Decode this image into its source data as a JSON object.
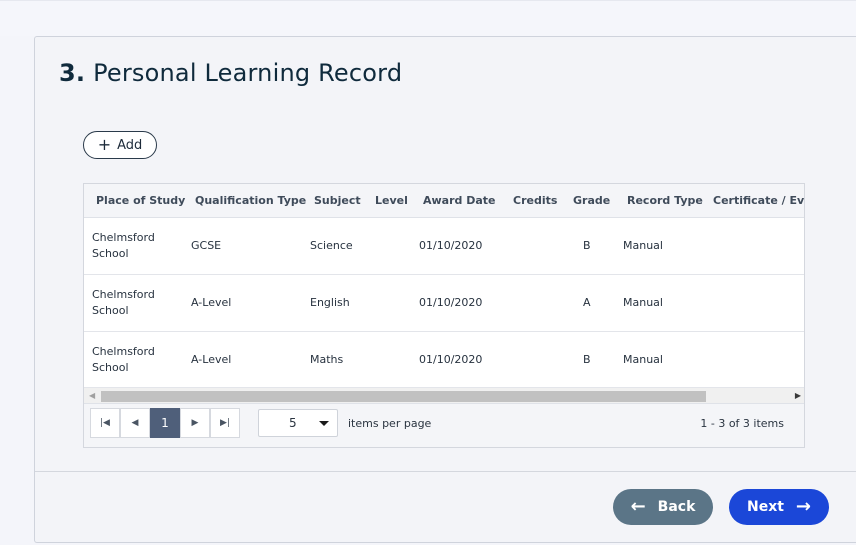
{
  "section": {
    "number": "3.",
    "title": "Personal Learning Record"
  },
  "add_button": {
    "icon": "plus-icon",
    "label": "Add"
  },
  "table": {
    "columns": [
      "Place of Study",
      "Qualification Type",
      "Subject",
      "Level",
      "Award Date",
      "Credits",
      "Grade",
      "Record Type",
      "Certificate / Evidence"
    ],
    "rows": [
      {
        "place_line1": "Chelmsford",
        "place_line2": "School",
        "qualification": "GCSE",
        "subject": "Science",
        "level": "",
        "award_date": "01/10/2020",
        "credits": "",
        "grade": "B",
        "record_type": "Manual"
      },
      {
        "place_line1": "Chelmsford",
        "place_line2": "School",
        "qualification": "A-Level",
        "subject": "English",
        "level": "",
        "award_date": "01/10/2020",
        "credits": "",
        "grade": "A",
        "record_type": "Manual"
      },
      {
        "place_line1": "Chelmsford",
        "place_line2": "School",
        "qualification": "A-Level",
        "subject": "Maths",
        "level": "",
        "award_date": "01/10/2020",
        "credits": "",
        "grade": "B",
        "record_type": "Manual"
      }
    ]
  },
  "pager": {
    "first_icon": "first-page-icon",
    "prev_icon": "prev-page-icon",
    "current_page": "1",
    "next_icon": "next-page-icon",
    "last_icon": "last-page-icon",
    "page_size": "5",
    "items_per_page_label": "items per page",
    "info": "1 - 3 of 3 items"
  },
  "footer": {
    "back_label": "Back",
    "next_label": "Next"
  },
  "colors": {
    "primary": "#1b47d8",
    "secondary": "#5b7587",
    "active_page": "#4f5f7a"
  }
}
